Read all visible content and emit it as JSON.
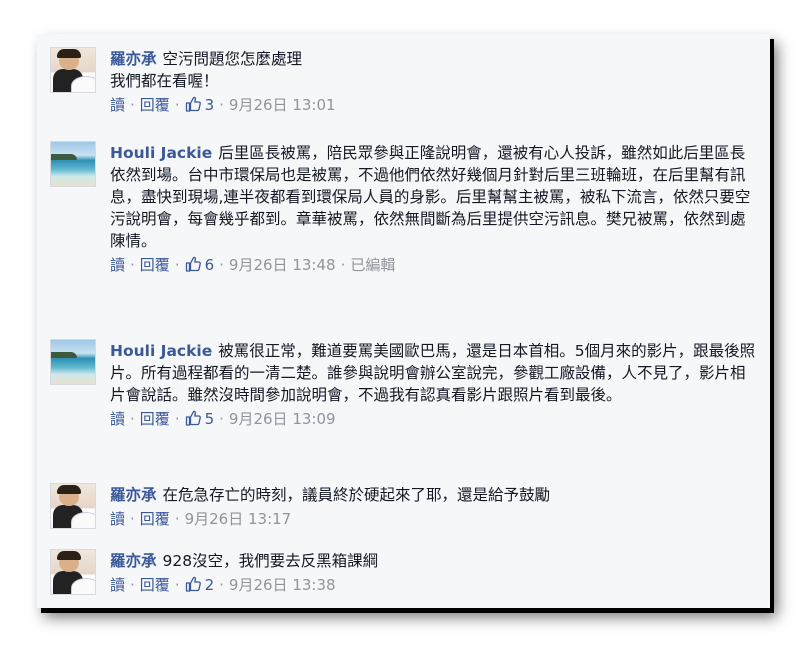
{
  "actions": {
    "read": "讀",
    "reply": "回覆",
    "separator": "·"
  },
  "comments": [
    {
      "author": "羅亦承",
      "text": "空污問題您怎麼處理\n我們都在看喔！",
      "likes": "3",
      "time": "9月26日 13:01",
      "edited": "",
      "avatar": "person-cake-photo"
    },
    {
      "author": "Houli Jackie",
      "text": "后里區長被罵，陪民眾參與正隆說明會，還被有心人投訴，雖然如此后里區長依然到場。台中市環保局也是被罵，不過他們依然好幾個月針對后里三班輪班，在后里幫有訊息，盡快到現場,連半夜都看到環保局人員的身影。后里幫幫主被罵，被私下流言，依然只要空污說明會，每會幾乎都到。章華被罵，依然無間斷為后里提供空污訊息。樊兄被罵，依然到處陳情。",
      "likes": "6",
      "time": "9月26日 13:48",
      "edited": "已編輯",
      "avatar": "beach-photo"
    },
    {
      "author": "Houli Jackie",
      "text": "被罵很正常，難道要罵美國歐巴馬，還是日本首相。5個月來的影片，跟最後照片。所有過程都看的一清二楚。誰參與說明會辦公室說完，參觀工廠設備，人不見了，影片相片會說話。雖然沒時間參加說明會，不過我有認真看影片跟照片看到最後。",
      "likes": "5",
      "time": "9月26日 13:09",
      "edited": "",
      "avatar": "beach-photo"
    },
    {
      "author": "羅亦承",
      "text": "在危急存亡的時刻，議員終於硬起來了耶，還是給予鼓勵",
      "likes": "",
      "time": "9月26日 13:17",
      "edited": "",
      "avatar": "person-cake-photo"
    },
    {
      "author": "羅亦承",
      "text": "928沒空，我們要去反黑箱課綱",
      "likes": "2",
      "time": "9月26日 13:38",
      "edited": "",
      "avatar": "person-cake-photo"
    }
  ],
  "colors": {
    "panel": "#f6f7f9",
    "author": "#3b5998",
    "link": "#3b5998",
    "muted": "#90949c",
    "text": "#141823"
  },
  "icons": {
    "like": "thumbs-up-icon"
  }
}
